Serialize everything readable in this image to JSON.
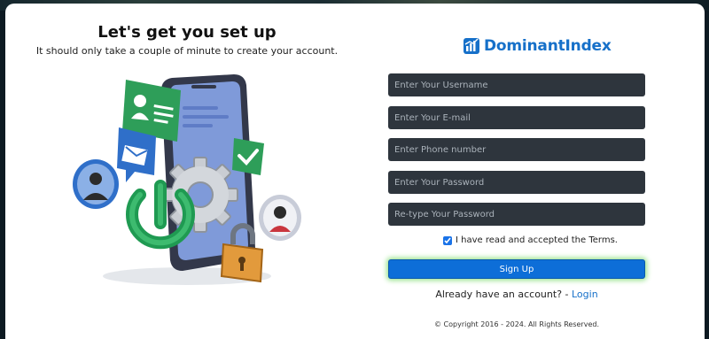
{
  "hero": {
    "title": "Let's get you set up",
    "subtitle": "It should only take a couple of minute to create your account."
  },
  "brand": {
    "name": "DominantIndex",
    "color": "#1670c9"
  },
  "form": {
    "username_placeholder": "Enter Your Username",
    "email_placeholder": "Enter Your E-mail",
    "phone_placeholder": "Enter Phone number",
    "password_placeholder": "Enter Your Password",
    "retype_placeholder": "Re-type Your Password",
    "terms_label": "I have read and accepted the Terms.",
    "terms_checked": true,
    "signup_label": "Sign Up",
    "already_text": "Already have an account? -",
    "login_label": "Login"
  },
  "footer": {
    "copyright": "© Copyright 2016 - 2024. All Rights Reserved."
  },
  "colors": {
    "field_bg": "#2e353d",
    "button_bg": "#0d6ed8",
    "button_glow": "#9be38f",
    "page_bg": "#0d1a22"
  },
  "icons": {
    "brand": "bar-chart-logo-icon",
    "illustration": "smartphone-signup-illustration"
  }
}
